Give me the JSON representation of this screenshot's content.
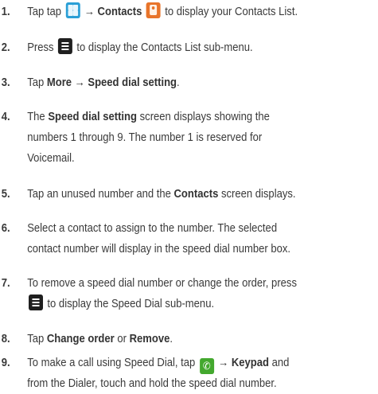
{
  "steps": [
    {
      "num": "1.",
      "lines": [
        {
          "a": "Tap tap",
          "b": "→ Contacts",
          "c": "to display your Contacts List."
        }
      ]
    },
    {
      "num": "2.",
      "lines": [
        {
          "a": "Press",
          "b": "to display the Contacts List sub-menu."
        }
      ]
    },
    {
      "num": "3.",
      "lines": [
        {
          "a": "Tap",
          "b": "More → Speed dial setting",
          "c": "."
        }
      ]
    },
    {
      "num": "4.",
      "lines": [
        {
          "a": "The",
          "b": "Speed dial setting",
          "c": "screen displays showing the"
        },
        {
          "a": "numbers 1 through 9. The number 1 is reserved for"
        },
        {
          "a": "Voicemail."
        }
      ]
    },
    {
      "num": "5.",
      "lines": [
        {
          "a": "Tap an unused number and the",
          "b": "Contacts",
          "c": "screen displays."
        }
      ]
    },
    {
      "num": "6.",
      "lines": [
        {
          "a": "Select a contact to assign to the number. The selected"
        },
        {
          "a": "contact number will display in the speed dial number box."
        }
      ]
    },
    {
      "num": "7.",
      "lines": [
        {
          "a": "To remove a speed dial number or change the order, press"
        },
        {
          "a": "to display the Speed Dial sub-menu."
        }
      ]
    },
    {
      "num": "8.",
      "lines": [
        {
          "a": "Tap",
          "b": "Change order",
          "c": "or",
          "d": "Remove",
          "e": "."
        }
      ]
    },
    {
      "num": "9.",
      "lines": [
        {
          "a": "To make a call using Speed Dial, tap",
          "b": "→ Keypad",
          "c": "and"
        },
        {
          "a": "from the Dialer, touch and hold the speed dial number."
        }
      ]
    }
  ],
  "icons": {
    "apps": "apps-grid-icon",
    "contacts": "contacts-app-icon",
    "menu": "menu-key-icon",
    "phone": "phone-icon"
  },
  "colors": {
    "text": "#3a3a3a",
    "apps_icon": "#2a9fd6",
    "contacts_icon": "#e8742a",
    "menu_key": "#1f1f1f",
    "phone_icon": "#43a82e"
  }
}
